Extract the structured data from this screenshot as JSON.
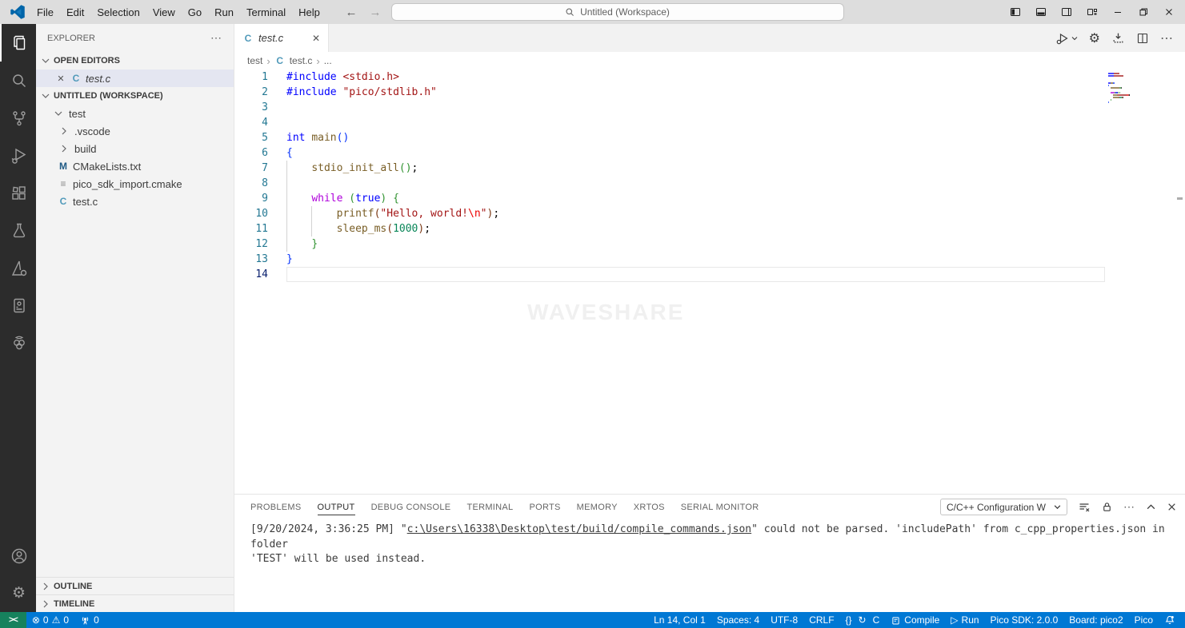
{
  "titlebar": {
    "menus": [
      "File",
      "Edit",
      "Selection",
      "View",
      "Go",
      "Run",
      "Terminal",
      "Help"
    ],
    "search_text": "Untitled (Workspace)"
  },
  "icons": {
    "braces": "{}",
    "sync": "↻",
    "run": "▷",
    "remote": "><",
    "error": "⊗",
    "warning": "⚠",
    "ellipsis": "⋯",
    "close": "✕",
    "gear": "⚙",
    "back_arrow": "←",
    "forward_arrow": "→",
    "breadcrumb_sep": "›",
    "generic_file": "≡"
  },
  "sidebar": {
    "title": "EXPLORER",
    "sections": {
      "open_editors": "OPEN EDITORS",
      "workspace": "UNTITLED (WORKSPACE)",
      "outline": "OUTLINE",
      "timeline": "TIMELINE"
    },
    "open_editor_items": [
      {
        "label": "test.c",
        "icon": "c"
      }
    ],
    "tree": [
      {
        "label": "test",
        "kind": "folder",
        "expanded": true,
        "level": 0
      },
      {
        "label": ".vscode",
        "kind": "folder",
        "expanded": false,
        "level": 1
      },
      {
        "label": "build",
        "kind": "folder",
        "expanded": false,
        "level": 1
      },
      {
        "label": "CMakeLists.txt",
        "kind": "cmake",
        "level": 1
      },
      {
        "label": "pico_sdk_import.cmake",
        "kind": "file",
        "level": 1
      },
      {
        "label": "test.c",
        "kind": "c",
        "level": 1
      }
    ]
  },
  "editor": {
    "tab_label": "test.c",
    "breadcrumbs": [
      "test",
      "test.c",
      "..."
    ],
    "watermark": "WAVESHARE",
    "lines": [
      {
        "n": 1,
        "tokens": [
          [
            "#include ",
            "kw"
          ],
          [
            "<stdio.h>",
            "str"
          ]
        ]
      },
      {
        "n": 2,
        "tokens": [
          [
            "#include ",
            "kw"
          ],
          [
            "\"pico/stdlib.h\"",
            "str"
          ]
        ]
      },
      {
        "n": 3,
        "tokens": []
      },
      {
        "n": 4,
        "tokens": []
      },
      {
        "n": 5,
        "tokens": [
          [
            "int ",
            "kw"
          ],
          [
            "main",
            "fn"
          ],
          [
            "()",
            "b1"
          ]
        ]
      },
      {
        "n": 6,
        "tokens": [
          [
            "{",
            "b1"
          ]
        ]
      },
      {
        "n": 7,
        "guides": [
          0
        ],
        "tokens": [
          [
            "    ",
            "def"
          ],
          [
            "stdio_init_all",
            "fn"
          ],
          [
            "()",
            "b2"
          ],
          [
            ";",
            "def"
          ]
        ]
      },
      {
        "n": 8,
        "guides": [
          0
        ],
        "tokens": []
      },
      {
        "n": 9,
        "guides": [
          0
        ],
        "tokens": [
          [
            "    ",
            "def"
          ],
          [
            "while ",
            "ctrl"
          ],
          [
            "(",
            "b2"
          ],
          [
            "true",
            "kw"
          ],
          [
            ")",
            "b2"
          ],
          [
            " ",
            "def"
          ],
          [
            "{",
            "b2"
          ]
        ]
      },
      {
        "n": 10,
        "guides": [
          0,
          4
        ],
        "tokens": [
          [
            "        ",
            "def"
          ],
          [
            "printf",
            "fn"
          ],
          [
            "(",
            "b3"
          ],
          [
            "\"Hello, world!",
            "str"
          ],
          [
            "\\n",
            "esc"
          ],
          [
            "\"",
            "str"
          ],
          [
            ")",
            "b3"
          ],
          [
            ";",
            "def"
          ]
        ]
      },
      {
        "n": 11,
        "guides": [
          0,
          4
        ],
        "tokens": [
          [
            "        ",
            "def"
          ],
          [
            "sleep_ms",
            "fn"
          ],
          [
            "(",
            "b3"
          ],
          [
            "1000",
            "num"
          ],
          [
            ")",
            "b3"
          ],
          [
            ";",
            "def"
          ]
        ]
      },
      {
        "n": 12,
        "guides": [
          0
        ],
        "tokens": [
          [
            "    ",
            "def"
          ],
          [
            "}",
            "b2"
          ]
        ]
      },
      {
        "n": 13,
        "tokens": [
          [
            "}",
            "b1"
          ]
        ]
      },
      {
        "n": 14,
        "tokens": [],
        "current": true
      }
    ]
  },
  "panel": {
    "tabs": [
      "PROBLEMS",
      "OUTPUT",
      "DEBUG CONSOLE",
      "TERMINAL",
      "PORTS",
      "MEMORY",
      "XRTOS",
      "SERIAL MONITOR"
    ],
    "active_tab": "OUTPUT",
    "dropdown_value": "C/C++ Configuration W",
    "output": [
      [
        [
          "[9/20/2024, 3:36:25 PM] \"",
          false
        ],
        [
          "c:\\Users\\16338\\Desktop\\test/build/compile_commands.json",
          true
        ],
        [
          "\" could not be parsed. 'includePath' from c_cpp_properties.json in folder",
          false
        ]
      ],
      [
        [
          "'TEST' will be used instead.",
          false
        ]
      ]
    ]
  },
  "statusbar": {
    "errors": "0",
    "warnings": "0",
    "ports": "0",
    "ln_col": "Ln 14, Col 1",
    "spaces": "Spaces: 4",
    "encoding": "UTF-8",
    "eol": "CRLF",
    "language": "C",
    "compile_label": "Compile",
    "run_label": "Run",
    "sdk_label": "Pico SDK: 2.0.0",
    "board_label": "Board: pico2",
    "pico_label": "Pico"
  },
  "colors": {
    "tokens": {
      "kw": "#0000ff",
      "ctrl": "#af00db",
      "fn": "#795e26",
      "str": "#a31515",
      "esc": "#ee0000",
      "num": "#098658",
      "b1": "#0431fa",
      "b2": "#319331",
      "b3": "#7b3814",
      "def": "#000000"
    },
    "statusbar_blue": "#0078d4",
    "remote_green": "#16825d",
    "c_file_icon": "#519aba",
    "cmake_file_icon": "#205b86",
    "line_number": "#237893"
  }
}
